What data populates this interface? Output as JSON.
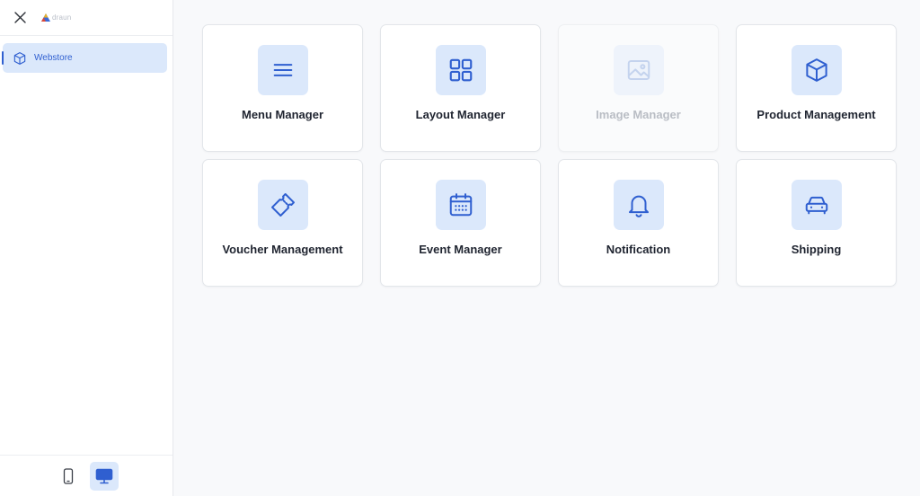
{
  "sidebar": {
    "logo_text": "draun",
    "nav_items": [
      {
        "label": "Webstore",
        "icon": "cube-icon",
        "active": true
      }
    ]
  },
  "cards": [
    {
      "label": "Menu Manager",
      "icon": "hamburger-menu-icon",
      "disabled": false
    },
    {
      "label": "Layout Manager",
      "icon": "grid-layout-icon",
      "disabled": false
    },
    {
      "label": "Image Manager",
      "icon": "image-icon",
      "disabled": true
    },
    {
      "label": "Product Management",
      "icon": "cube-icon",
      "disabled": false
    },
    {
      "label": "Voucher Management",
      "icon": "ticket-icon",
      "disabled": false
    },
    {
      "label": "Event Manager",
      "icon": "calendar-icon",
      "disabled": false
    },
    {
      "label": "Notification",
      "icon": "bell-icon",
      "disabled": false
    },
    {
      "label": "Shipping",
      "icon": "car-icon",
      "disabled": false
    }
  ],
  "colors": {
    "accent": "#2f5fd0",
    "accent_soft": "#dbe8fb",
    "disabled_text": "#b9bdc4",
    "background": "#f8f9fb"
  }
}
